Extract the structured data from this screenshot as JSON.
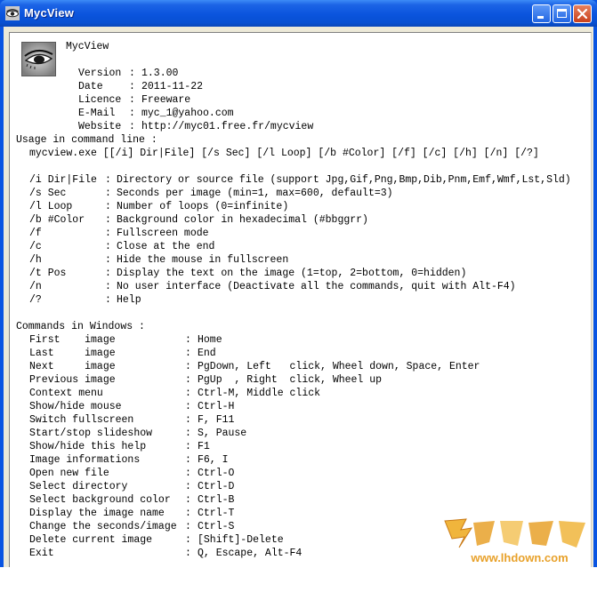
{
  "window": {
    "title": "MycView",
    "icon": "eye-icon",
    "buttons": {
      "minimize": "minimize-icon",
      "maximize": "maximize-icon",
      "close": "close-icon"
    }
  },
  "about": {
    "name": "MycView",
    "fields": [
      {
        "key": "Version",
        "value": "1.3.00"
      },
      {
        "key": "Date",
        "value": "2011-11-22"
      },
      {
        "key": "Licence",
        "value": "Freeware"
      },
      {
        "key": "E-Mail",
        "value": "myc_1@yahoo.com"
      },
      {
        "key": "Website",
        "value": "http://myc01.free.fr/mycview"
      }
    ]
  },
  "usage": {
    "heading": "Usage in command line :",
    "syntax": "mycview.exe [[/i] Dir|File] [/s Sec] [/l Loop] [/b #Color] [/f] [/c] [/h] [/n] [/?]",
    "options": [
      {
        "key": "/i Dir|File",
        "value": "Directory or source file (support Jpg,Gif,Png,Bmp,Dib,Pnm,Emf,Wmf,Lst,Sld)"
      },
      {
        "key": "/s Sec",
        "value": "Seconds per image (min=1, max=600, default=3)"
      },
      {
        "key": "/l Loop",
        "value": "Number of loops (0=infinite)"
      },
      {
        "key": "/b #Color",
        "value": "Background color in hexadecimal (#bbggrr)"
      },
      {
        "key": "/f",
        "value": "Fullscreen mode"
      },
      {
        "key": "/c",
        "value": "Close at the end"
      },
      {
        "key": "/h",
        "value": "Hide the mouse in fullscreen"
      },
      {
        "key": "/t Pos",
        "value": "Display the text on the image (1=top, 2=bottom, 0=hidden)"
      },
      {
        "key": "/n",
        "value": "No user interface (Deactivate all the commands, quit with Alt-F4)"
      },
      {
        "key": "/?",
        "value": "Help"
      }
    ]
  },
  "commands": {
    "heading": "Commands in Windows :",
    "items": [
      {
        "key": "First    image",
        "value": "Home"
      },
      {
        "key": "Last     image",
        "value": "End"
      },
      {
        "key": "Next     image",
        "value": "PgDown, Left   click, Wheel down, Space, Enter"
      },
      {
        "key": "Previous image",
        "value": "PgUp  , Right  click, Wheel up"
      },
      {
        "key": "Context menu",
        "value": "Ctrl-M, Middle click"
      },
      {
        "key": "Show/hide mouse",
        "value": "Ctrl-H"
      },
      {
        "key": "Switch fullscreen",
        "value": "F, F11"
      },
      {
        "key": "Start/stop slideshow",
        "value": "S, Pause"
      },
      {
        "key": "Show/hide this help",
        "value": "F1"
      },
      {
        "key": "Image informations",
        "value": "F6, I"
      },
      {
        "key": "Open new file",
        "value": "Ctrl-O"
      },
      {
        "key": "Select directory",
        "value": "Ctrl-D"
      },
      {
        "key": "Select background color",
        "value": "Ctrl-B"
      },
      {
        "key": "Display the image name",
        "value": "Ctrl-T"
      },
      {
        "key": "Change the seconds/image",
        "value": "Ctrl-S"
      },
      {
        "key": "Delete current image",
        "value": "[Shift]-Delete"
      },
      {
        "key": "Exit",
        "value": "Q, Escape, Alt-F4"
      }
    ]
  },
  "watermark": {
    "text": "www.lhdown.com",
    "accent": "#e8a12a"
  }
}
